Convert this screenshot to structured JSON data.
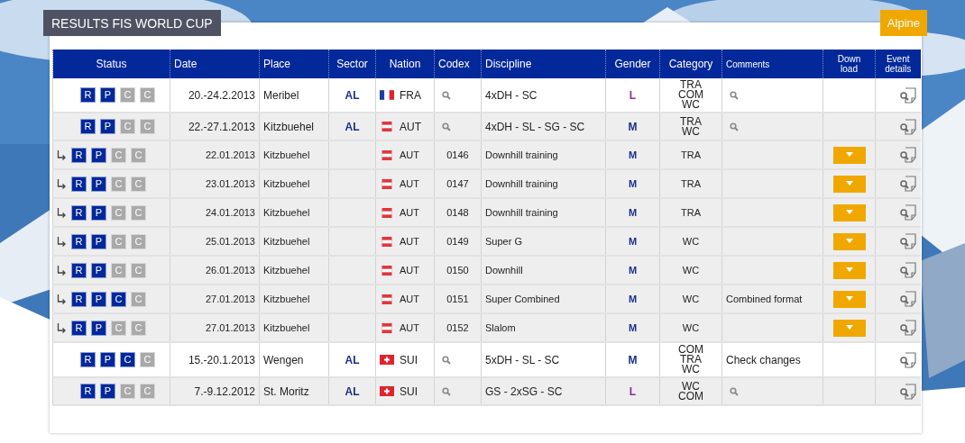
{
  "title": "RESULTS FIS WORLD CUP",
  "sport_tab": "Alpine",
  "columns": [
    "Status",
    "Date",
    "Place",
    "Sector",
    "Nation",
    "Codex",
    "Discipline",
    "Gender",
    "Category",
    "Comments",
    "Down\nload",
    "Event\ndetails"
  ],
  "rows": [
    {
      "kind": "event",
      "shaded": false,
      "status": [
        {
          "label": "R",
          "on": true
        },
        {
          "label": "P",
          "on": true
        },
        {
          "label": "C",
          "on": false
        },
        {
          "label": "C",
          "on": false
        }
      ],
      "date": "20.-24.2.2013",
      "place": "Meribel",
      "sector": "AL",
      "nation": {
        "kind": "fr",
        "code": "FRA"
      },
      "codex_search": true,
      "discipline": "4xDH - SC",
      "gender": {
        "text": "L",
        "color": "#8b2d9b"
      },
      "category": [
        "TRA",
        "COM",
        "WC"
      ],
      "comments_search": true,
      "download": false
    },
    {
      "kind": "event",
      "shaded": true,
      "status": [
        {
          "label": "R",
          "on": true
        },
        {
          "label": "P",
          "on": true
        },
        {
          "label": "C",
          "on": false
        },
        {
          "label": "C",
          "on": false
        }
      ],
      "date": "22.-27.1.2013",
      "place": "Kitzbuehel",
      "sector": "AL",
      "nation": {
        "kind": "at",
        "code": "AUT"
      },
      "codex_search": true,
      "discipline": "4xDH - SL - SG - SC",
      "gender": {
        "text": "M",
        "color": "#1a2f8a"
      },
      "category": [
        "TRA",
        "WC"
      ],
      "comments_search": true,
      "download": false
    },
    {
      "kind": "race",
      "shaded": true,
      "status": [
        {
          "label": "R",
          "on": true
        },
        {
          "label": "P",
          "on": true
        },
        {
          "label": "C",
          "on": false
        },
        {
          "label": "C",
          "on": false
        }
      ],
      "date": "22.01.2013",
      "place": "Kitzbuehel",
      "nation": {
        "kind": "at",
        "code": "AUT"
      },
      "codex": "0146",
      "discipline": "Downhill training",
      "gender": {
        "text": "M",
        "color": "#1a2f8a"
      },
      "category": [
        "TRA"
      ],
      "download": true
    },
    {
      "kind": "race",
      "shaded": true,
      "status": [
        {
          "label": "R",
          "on": true
        },
        {
          "label": "P",
          "on": true
        },
        {
          "label": "C",
          "on": false
        },
        {
          "label": "C",
          "on": false
        }
      ],
      "date": "23.01.2013",
      "place": "Kitzbuehel",
      "nation": {
        "kind": "at",
        "code": "AUT"
      },
      "codex": "0147",
      "discipline": "Downhill training",
      "gender": {
        "text": "M",
        "color": "#1a2f8a"
      },
      "category": [
        "TRA"
      ],
      "download": true
    },
    {
      "kind": "race",
      "shaded": true,
      "status": [
        {
          "label": "R",
          "on": true
        },
        {
          "label": "P",
          "on": true
        },
        {
          "label": "C",
          "on": false
        },
        {
          "label": "C",
          "on": false
        }
      ],
      "date": "24.01.2013",
      "place": "Kitzbuehel",
      "nation": {
        "kind": "at",
        "code": "AUT"
      },
      "codex": "0148",
      "discipline": "Downhill training",
      "gender": {
        "text": "M",
        "color": "#1a2f8a"
      },
      "category": [
        "TRA"
      ],
      "download": true
    },
    {
      "kind": "race",
      "shaded": true,
      "status": [
        {
          "label": "R",
          "on": true
        },
        {
          "label": "P",
          "on": true
        },
        {
          "label": "C",
          "on": false
        },
        {
          "label": "C",
          "on": false
        }
      ],
      "date": "25.01.2013",
      "place": "Kitzbuehel",
      "nation": {
        "kind": "at",
        "code": "AUT"
      },
      "codex": "0149",
      "discipline": "Super G",
      "gender": {
        "text": "M",
        "color": "#1a2f8a"
      },
      "category": [
        "WC"
      ],
      "download": true
    },
    {
      "kind": "race",
      "shaded": true,
      "status": [
        {
          "label": "R",
          "on": true
        },
        {
          "label": "P",
          "on": true
        },
        {
          "label": "C",
          "on": false
        },
        {
          "label": "C",
          "on": false
        }
      ],
      "date": "26.01.2013",
      "place": "Kitzbuehel",
      "nation": {
        "kind": "at",
        "code": "AUT"
      },
      "codex": "0150",
      "discipline": "Downhill",
      "gender": {
        "text": "M",
        "color": "#1a2f8a"
      },
      "category": [
        "WC"
      ],
      "download": true
    },
    {
      "kind": "race",
      "shaded": true,
      "status": [
        {
          "label": "R",
          "on": true
        },
        {
          "label": "P",
          "on": true
        },
        {
          "label": "C",
          "on": true
        },
        {
          "label": "C",
          "on": false
        }
      ],
      "date": "27.01.2013",
      "place": "Kitzbuehel",
      "nation": {
        "kind": "at",
        "code": "AUT"
      },
      "codex": "0151",
      "discipline": "Super Combined",
      "gender": {
        "text": "M",
        "color": "#1a2f8a"
      },
      "category": [
        "WC"
      ],
      "comments": "Combined format",
      "download": true
    },
    {
      "kind": "race",
      "shaded": true,
      "status": [
        {
          "label": "R",
          "on": true
        },
        {
          "label": "P",
          "on": true
        },
        {
          "label": "C",
          "on": false
        },
        {
          "label": "C",
          "on": false
        }
      ],
      "date": "27.01.2013",
      "place": "Kitzbuehel",
      "nation": {
        "kind": "at",
        "code": "AUT"
      },
      "codex": "0152",
      "discipline": "Slalom",
      "gender": {
        "text": "M",
        "color": "#1a2f8a"
      },
      "category": [
        "WC"
      ],
      "download": true
    },
    {
      "kind": "event",
      "shaded": false,
      "status": [
        {
          "label": "R",
          "on": true
        },
        {
          "label": "P",
          "on": true
        },
        {
          "label": "C",
          "on": true
        },
        {
          "label": "C",
          "on": false
        }
      ],
      "date": "15.-20.1.2013",
      "place": "Wengen",
      "sector": "AL",
      "nation": {
        "kind": "ch",
        "code": "SUI"
      },
      "codex_search": true,
      "discipline": "5xDH - SL - SC",
      "gender": {
        "text": "M",
        "color": "#1a2f8a"
      },
      "category": [
        "COM",
        "TRA",
        "WC"
      ],
      "comments": "Check changes",
      "download": false
    },
    {
      "kind": "event",
      "shaded": true,
      "status": [
        {
          "label": "R",
          "on": true
        },
        {
          "label": "P",
          "on": true
        },
        {
          "label": "C",
          "on": false
        },
        {
          "label": "C",
          "on": false
        }
      ],
      "date": "7.-9.12.2012",
      "place": "St. Moritz",
      "sector": "AL",
      "nation": {
        "kind": "ch",
        "code": "SUI"
      },
      "codex_search": true,
      "discipline": "GS - 2xSG - SC",
      "gender": {
        "text": "L",
        "color": "#8b2d9b"
      },
      "category": [
        "WC",
        "COM"
      ],
      "comments_search": true,
      "download": false
    }
  ]
}
